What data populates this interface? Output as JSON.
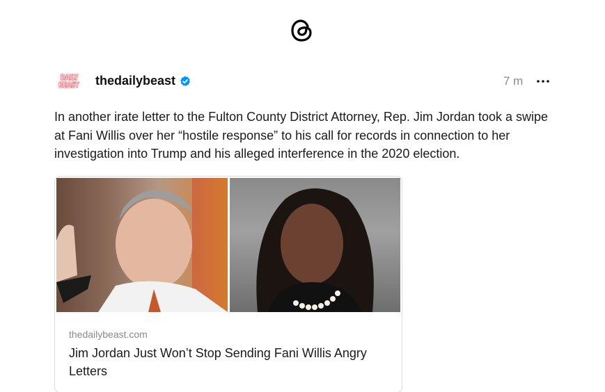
{
  "app": {
    "logo_icon": "threads-logo-icon"
  },
  "post": {
    "avatar_lines": [
      "DAILY",
      "BEAST"
    ],
    "username": "thedailybeast",
    "verified_icon": "verified-badge-icon",
    "time": "7 m",
    "more_icon": "more-options-icon",
    "text": "In another irate letter to the Fulton County District Attorney, Rep. Jim Jordan took a swipe at Fani Willis over her “hostile response” to his call for records in connection to her investigation into Trump and his alleged interference in the 2020 election."
  },
  "link_card": {
    "domain": "thedailybeast.com",
    "title": "Jim Jordan Just Won’t Stop Sending Fani Willis Angry Letters"
  },
  "colors": {
    "verified_blue": "#0095f6",
    "brand_red": "#e53946",
    "muted_gray": "#8a8a8a",
    "border": "#dcdcdc"
  }
}
